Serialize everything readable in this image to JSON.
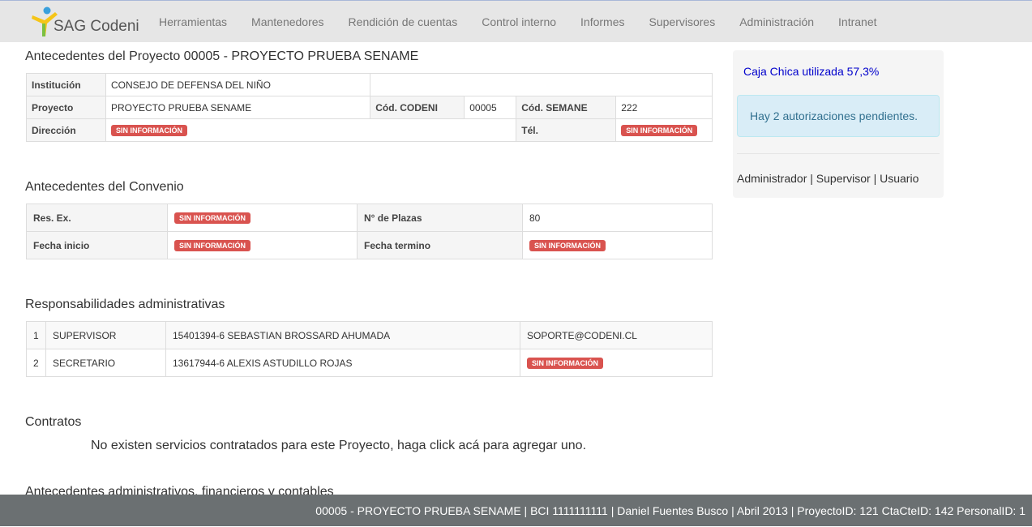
{
  "nav": {
    "brand": "SAG Codeni",
    "items": [
      "Herramientas",
      "Mantenedores",
      "Rendición de cuentas",
      "Control interno",
      "Informes",
      "Supervisores",
      "Administración",
      "Intranet"
    ]
  },
  "proyecto": {
    "title": "Antecedentes del Proyecto 00005 - PROYECTO PRUEBA SENAME",
    "institucion_label": "Institución",
    "institucion": "CONSEJO DE DEFENSA DEL NIÑO",
    "proyecto_label": "Proyecto",
    "proyecto": "PROYECTO PRUEBA SENAME",
    "cod_codeni_label": "Cód. CODENI",
    "cod_codeni": "00005",
    "cod_sename_label": "Cód. SEMANE",
    "cod_sename": "222",
    "direccion_label": "Dirección",
    "direccion": "SIN INFORMACIÓN",
    "tel_label": "Tél.",
    "tel": "SIN INFORMACIÓN"
  },
  "convenio": {
    "title": "Antecedentes del Convenio",
    "res_label": "Res. Ex.",
    "res": "SIN INFORMACIÓN",
    "plazas_label": "N° de Plazas",
    "plazas": "80",
    "inicio_label": "Fecha inicio",
    "inicio": "SIN INFORMACIÓN",
    "termino_label": "Fecha termino",
    "termino": "SIN INFORMACIÓN"
  },
  "responsabilidades": {
    "title": "Responsabilidades administrativas",
    "rows": [
      {
        "n": "1",
        "cargo": "SUPERVISOR",
        "persona": "15401394-6 SEBASTIAN BROSSARD AHUMADA",
        "email": "SOPORTE@CODENI.CL"
      },
      {
        "n": "2",
        "cargo": "SECRETARIO",
        "persona": "13617944-6 ALEXIS ASTUDILLO ROJAS",
        "email": "SIN INFORMACIÓN"
      }
    ]
  },
  "contratos": {
    "title": "Contratos",
    "msg_before": "No existen servicios contratados para este Proyecto, haga ",
    "link": "click acá",
    "msg_after": " para agregar uno."
  },
  "next_section": "Antecedentes administrativos, financieros y contables",
  "side": {
    "caja": "Caja Chica utilizada 57,3%",
    "alert": "Hay 2 autorizaciones pendientes.",
    "roles": "Administrador | Supervisor | Usuario"
  },
  "footer": "00005 - PROYECTO PRUEBA SENAME | BCI 1111111111 | Daniel Fuentes Busco | Abril 2013 | ProyectoID: 121 CtaCteID: 142 PersonalID: 1"
}
